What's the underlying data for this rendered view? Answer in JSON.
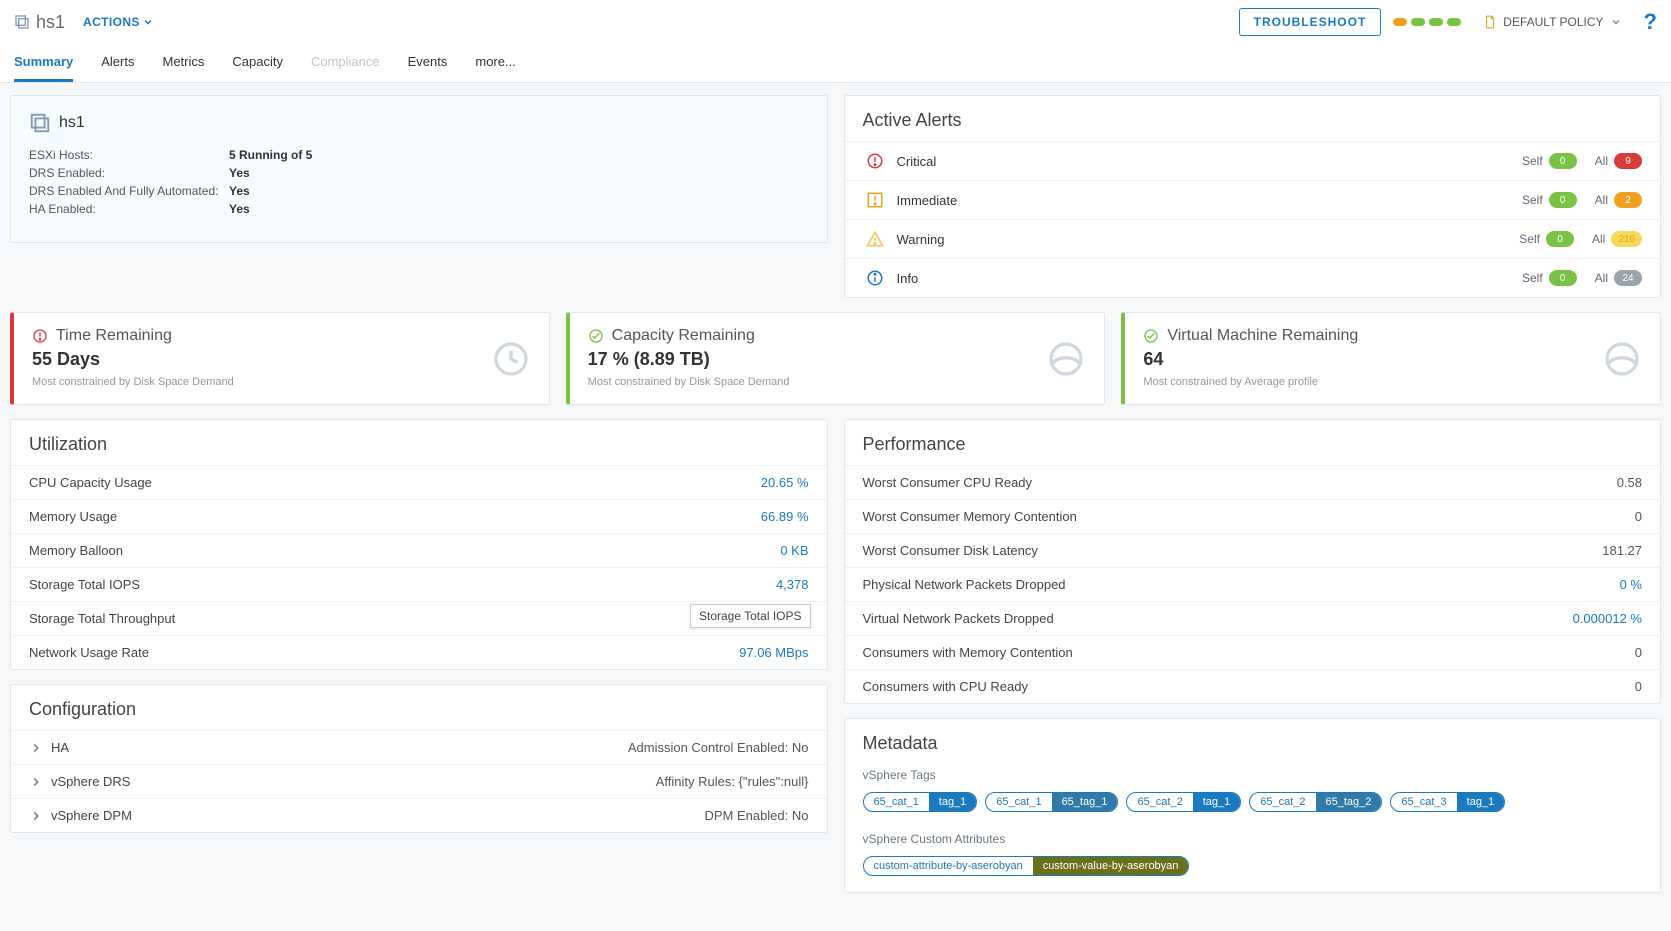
{
  "header": {
    "title": "hs1",
    "actions_label": "ACTIONS",
    "troubleshoot_label": "TROUBLESHOOT",
    "policy_label": "DEFAULT POLICY",
    "health": [
      "#f0a020",
      "#79c245",
      "#79c245",
      "#79c245"
    ]
  },
  "tabs": [
    "Summary",
    "Alerts",
    "Metrics",
    "Capacity",
    "Compliance",
    "Events",
    "more..."
  ],
  "tabs_active_index": 0,
  "tabs_disabled_indices": [
    4
  ],
  "summary": {
    "name": "hs1",
    "kv": [
      {
        "k": "ESXi Hosts:",
        "v": "5 Running of 5"
      },
      {
        "k": "DRS Enabled:",
        "v": "Yes"
      },
      {
        "k": "DRS Enabled And Fully Automated:",
        "v": "Yes"
      },
      {
        "k": "HA Enabled:",
        "v": "Yes"
      }
    ]
  },
  "active_alerts": {
    "title": "Active Alerts",
    "rows": [
      {
        "name": "Critical",
        "color": "#d93a3a",
        "glyph": "alert-circle",
        "self": "0",
        "all": "9",
        "all_color": "red"
      },
      {
        "name": "Immediate",
        "color": "#f0a020",
        "glyph": "alert-square",
        "self": "0",
        "all": "2",
        "all_color": "orange"
      },
      {
        "name": "Warning",
        "color": "#f6c64f",
        "glyph": "alert-triangle",
        "self": "0",
        "all": "216",
        "all_color": "yellow"
      },
      {
        "name": "Info",
        "color": "#1b79c0",
        "glyph": "info",
        "self": "0",
        "all": "24",
        "all_color": "grey"
      }
    ],
    "self_label": "Self",
    "all_label": "All"
  },
  "kpis": [
    {
      "title": "Time Remaining",
      "value": "55 Days",
      "sub": "Most constrained by Disk Space Demand",
      "color": "red",
      "icon": "clock",
      "status_color": "#d93a3a"
    },
    {
      "title": "Capacity Remaining",
      "value": "17 % (8.89 TB)",
      "sub": "Most constrained by Disk Space Demand",
      "color": "green",
      "icon": "gauge",
      "status_color": "#79c245"
    },
    {
      "title": "Virtual Machine Remaining",
      "value": "64",
      "sub": "Most constrained by Average profile",
      "color": "green",
      "icon": "gauge",
      "status_color": "#79c245"
    }
  ],
  "utilization": {
    "title": "Utilization",
    "rows": [
      {
        "label": "CPU Capacity Usage",
        "value": "20.65 %",
        "link": true
      },
      {
        "label": "Memory Usage",
        "value": "66.89 %",
        "link": true
      },
      {
        "label": "Memory Balloon",
        "value": "0 KB",
        "link": true
      },
      {
        "label": "Storage Total IOPS",
        "value": "4,378",
        "link": true
      },
      {
        "label": "Storage Total Throughput",
        "value": "",
        "link": true,
        "tooltip": "Storage Total IOPS"
      },
      {
        "label": "Network Usage Rate",
        "value": "97.06 MBps",
        "link": true
      }
    ]
  },
  "configuration": {
    "title": "Configuration",
    "rows": [
      {
        "label": "HA",
        "value": "Admission Control Enabled: No"
      },
      {
        "label": "vSphere DRS",
        "value": "Affinity Rules: {\"rules\":null}"
      },
      {
        "label": "vSphere DPM",
        "value": "DPM Enabled: No"
      }
    ]
  },
  "performance": {
    "title": "Performance",
    "rows": [
      {
        "label": "Worst Consumer CPU Ready",
        "value": "0.58"
      },
      {
        "label": "Worst Consumer Memory Contention",
        "value": "0"
      },
      {
        "label": "Worst Consumer Disk Latency",
        "value": "181.27"
      },
      {
        "label": "Physical Network Packets Dropped",
        "value": "0 %",
        "link": true
      },
      {
        "label": "Virtual Network Packets Dropped",
        "value": "0.000012 %",
        "link": true
      },
      {
        "label": "Consumers with Memory Contention",
        "value": "0"
      },
      {
        "label": "Consumers with CPU Ready",
        "value": "0"
      }
    ]
  },
  "metadata": {
    "title": "Metadata",
    "tags_label": "vSphere Tags",
    "tags": [
      {
        "cat": "65_cat_1",
        "tag": "tag_1",
        "style": "std"
      },
      {
        "cat": "65_cat_1",
        "tag": "65_tag_1",
        "style": "alt"
      },
      {
        "cat": "65_cat_2",
        "tag": "tag_1",
        "style": "std"
      },
      {
        "cat": "65_cat_2",
        "tag": "65_tag_2",
        "style": "alt"
      },
      {
        "cat": "65_cat_3",
        "tag": "tag_1",
        "style": "std"
      }
    ],
    "attrs_label": "vSphere Custom Attributes",
    "attrs": [
      {
        "cat": "custom-attribute-by-aserobyan",
        "tag": "custom-value-by-aserobyan",
        "style": "dark"
      }
    ]
  }
}
